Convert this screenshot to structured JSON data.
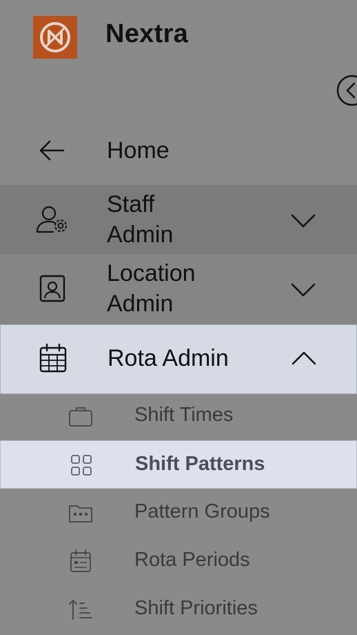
{
  "brand": {
    "name": "Nextra",
    "logo_color": "#b5521f"
  },
  "nav": {
    "home": {
      "label": "Home",
      "icon": "arrow-left-icon"
    },
    "staff": {
      "label_line1": "Staff",
      "label_line2": "Admin",
      "icon": "user-gear-icon",
      "expanded": false
    },
    "location": {
      "label_line1": "Location",
      "label_line2": "Admin",
      "icon": "id-badge-icon",
      "expanded": false
    },
    "rota": {
      "label": "Rota Admin",
      "icon": "calendar-icon",
      "expanded": true
    }
  },
  "submenu": [
    {
      "label": "Shift Times",
      "icon": "briefcase-icon",
      "active": false
    },
    {
      "label": "Shift Patterns",
      "icon": "grid-icon",
      "active": true
    },
    {
      "label": "Pattern Groups",
      "icon": "folder-dots-icon",
      "active": false
    },
    {
      "label": "Rota Periods",
      "icon": "calendar-list-icon",
      "active": false
    },
    {
      "label": "Shift Priorities",
      "icon": "sort-ascending-icon",
      "active": false
    }
  ],
  "colors": {
    "active_bg": "#dde1ee",
    "rota_bg": "#d5dae4",
    "sidebar_bg": "#8a8a8a"
  }
}
